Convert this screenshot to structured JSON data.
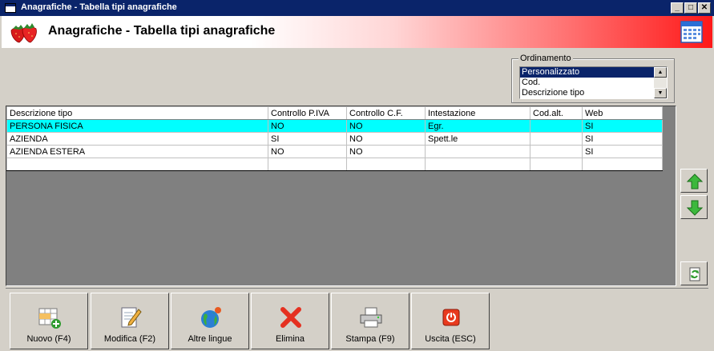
{
  "window": {
    "title": "Anagrafiche - Tabella tipi anagrafiche",
    "minimize": "_",
    "maximize": "□",
    "close": "✕"
  },
  "header": {
    "heading": "Anagrafiche - Tabella tipi anagrafiche",
    "logo_icon": "strawberries-icon",
    "calendar_icon": "calendar-icon"
  },
  "ordinamento": {
    "legend": "Ordinamento",
    "options": [
      "Personalizzato",
      "Cod.",
      "Descrizione tipo"
    ],
    "selected": "Personalizzato"
  },
  "table": {
    "columns": [
      "Descrizione tipo",
      "Controllo P.IVA",
      "Controllo C.F.",
      "Intestazione",
      "Cod.alt.",
      "Web"
    ],
    "rows": [
      [
        "PERSONA FISICA",
        "NO",
        "NO",
        "Egr.",
        "",
        "SI"
      ],
      [
        "AZIENDA",
        "SI",
        "NO",
        "Spett.le",
        "",
        "SI"
      ],
      [
        "AZIENDA ESTERA",
        "NO",
        "NO",
        "",
        "",
        "SI"
      ],
      [
        "",
        "",
        "",
        "",
        "",
        ""
      ]
    ],
    "selected_row": 0
  },
  "side_buttons": {
    "up_icon": "green-arrow-up-icon",
    "down_icon": "green-arrow-down-icon",
    "refresh_icon": "refresh-document-icon"
  },
  "toolbar": {
    "buttons": [
      {
        "label": "Nuovo (F4)",
        "icon": "new-table-icon"
      },
      {
        "label": "Modifica (F2)",
        "icon": "edit-document-icon"
      },
      {
        "label": "Altre lingue",
        "icon": "globe-icon"
      },
      {
        "label": "Elimina",
        "icon": "delete-x-icon"
      },
      {
        "label": "Stampa (F9)",
        "icon": "printer-icon"
      },
      {
        "label": "Uscita (ESC)",
        "icon": "exit-icon"
      }
    ]
  },
  "colors": {
    "titlebar": "#0a246a",
    "selected_row": "#00ffff",
    "header_gradient_end": "#ff1818"
  }
}
